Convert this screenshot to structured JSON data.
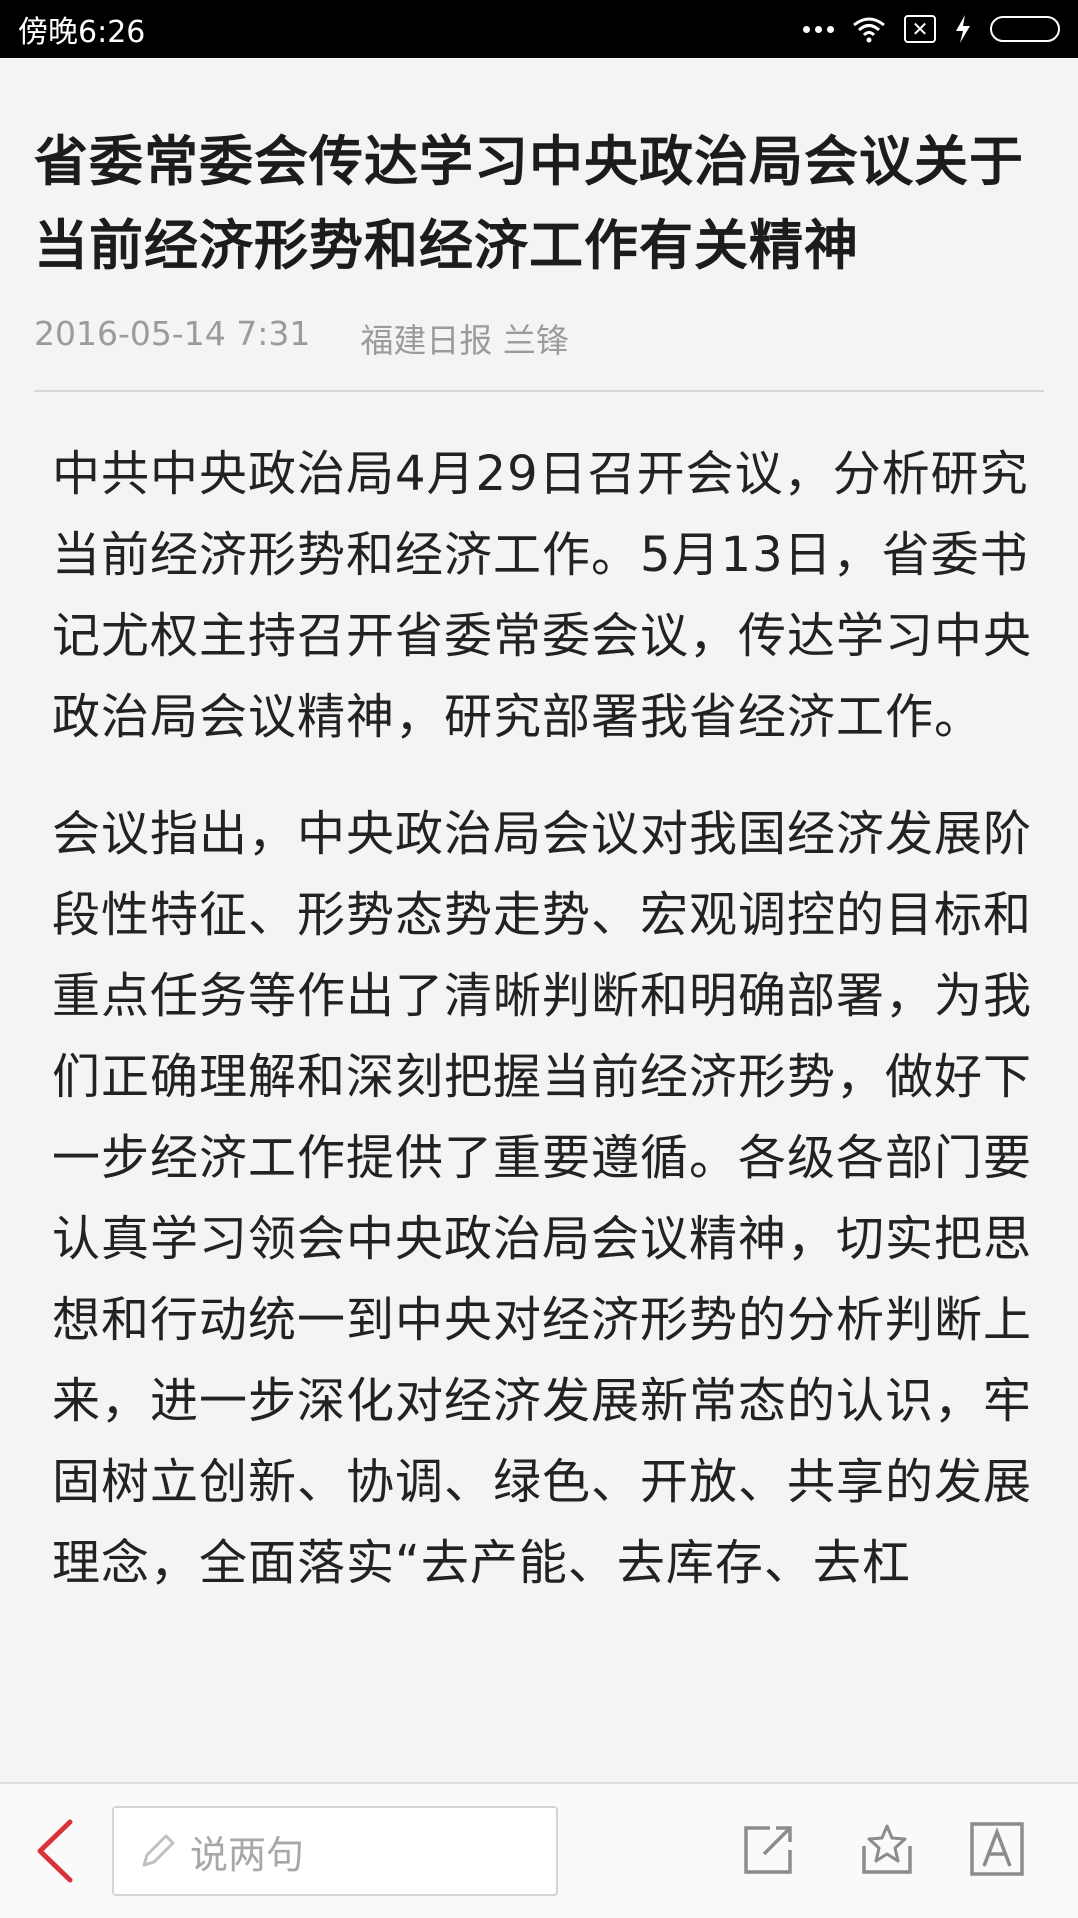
{
  "status_bar": {
    "time": "傍晚6:26"
  },
  "article": {
    "title": "省委常委会传达学习中央政治局会议关于当前经济形势和经济工作有关精神",
    "date": "2016-05-14 7:31",
    "source": "福建日报 兰锋",
    "paragraphs": [
      "中共中央政治局4月29日召开会议，分析研究当前经济形势和经济工作。5月13日，省委书记尤权主持召开省委常委会议，传达学习中央政治局会议精神，研究部署我省经济工作。",
      "会议指出，中央政治局会议对我国经济发展阶段性特征、形势态势走势、宏观调控的目标和重点任务等作出了清晰判断和明确部署，为我们正确理解和深刻把握当前经济形势，做好下一步经济工作提供了重要遵循。各级各部门要认真学习领会中央政治局会议精神，切实把思想和行动统一到中央对经济形势的分析判断上来，进一步深化对经济发展新常态的认识，牢固树立创新、协调、绿色、开放、共享的发展理念，全面落实“去产能、去库存、去杠"
    ]
  },
  "toolbar": {
    "comment_placeholder": "说两句"
  },
  "icons": {
    "back": "chevron-left-icon",
    "pencil": "pencil-icon",
    "share": "share-icon",
    "favorite": "star-icon",
    "font": "font-size-icon"
  },
  "colors": {
    "accent": "#d9333a",
    "meta_text": "#9b9b9b",
    "icon_gray": "#8c8c8c"
  }
}
